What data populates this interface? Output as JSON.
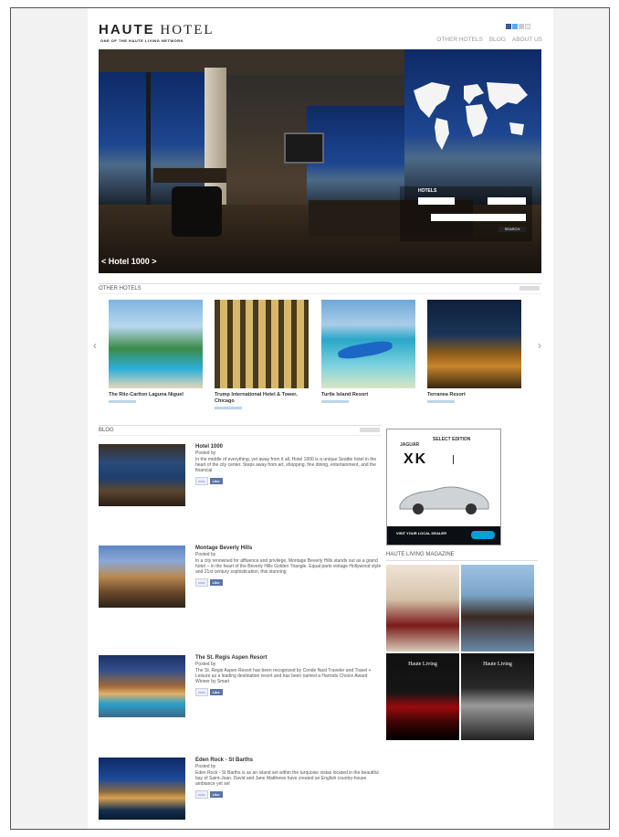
{
  "site": {
    "logo_bold": "HAUTE",
    "logo_light": " HOTEL",
    "tagline": "ONE OF THE HAUTE LIVING NETWORK"
  },
  "nav": [
    "OTHER HOTELS",
    "BLOG",
    "ABOUT US"
  ],
  "hero": {
    "caption": "< Hotel 1000 >",
    "search_label": "HOTELS",
    "search_button": "SEARCH"
  },
  "other_hotels": {
    "title": "OTHER HOTELS",
    "items": [
      {
        "name": "The Ritz-Carlton Laguna Niguel"
      },
      {
        "name": "Trump International Hotel & Tower, Chicago"
      },
      {
        "name": "Turtle Island Resort"
      },
      {
        "name": "Terranea Resort"
      }
    ]
  },
  "blog": {
    "title": "BLOG",
    "posts": [
      {
        "title": "Hotel 1000",
        "by": "Posted by",
        "body": "In the middle of everything, yet away from it all, Hotel 1000 is a unique Seattle hotel in the heart of the city center. Steps away from art, shopping, fine dining, entertainment, and the financial"
      },
      {
        "title": "Montage Beverly Hills",
        "by": "Posted by",
        "body": "In a city renowned for affluence and privilege, Montage Beverly Hills stands out as a grand hotel -- in the heart of the Beverly Hills Golden Triangle. Equal parts vintage Hollywood style and 21st century sophistication, this stunning"
      },
      {
        "title": "The St. Regis Aspen Resort",
        "by": "Posted by",
        "body": "The St. Regis Aspen Resort has been recognized by Conde Nast Traveler and Travel + Leisure as a leading destination resort and has been named a Harrods Choice Award Winner by Smart"
      },
      {
        "title": "Eden Rock - St Barths",
        "by": "Posted by",
        "body": "Eden Rock - St Barths is as an island set within the turquoise vistas located in the beautiful bay of Saint-Jean. David and Jane Matthews have created an English country-house ambiance yet set"
      }
    ],
    "like_label": "Like"
  },
  "ad": {
    "brand": "JAGUAR",
    "headline": "SELECT EDITION",
    "model": "XK",
    "cta": "VISIT YOUR LOCAL DEALER"
  },
  "magazine": {
    "title": "HAUTE LIVING MAGAZINE",
    "cover_brand": "Haute Living"
  }
}
